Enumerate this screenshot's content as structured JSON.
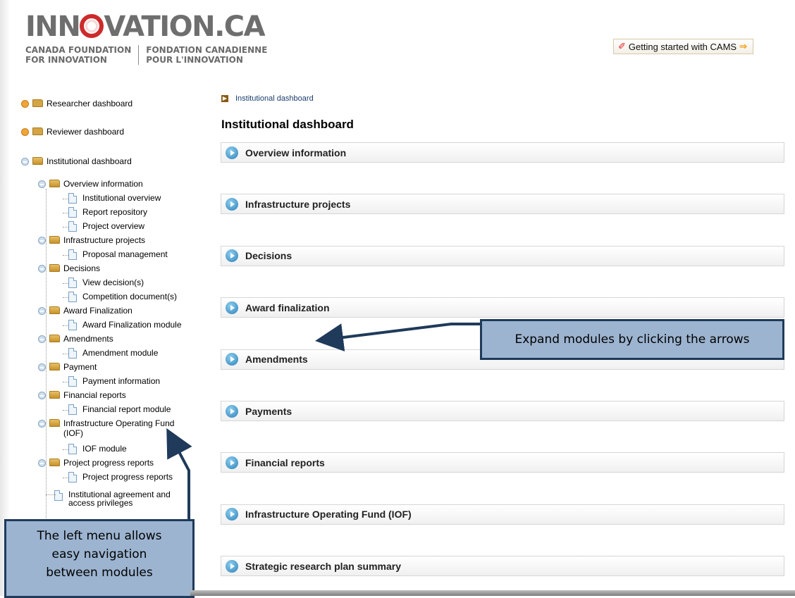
{
  "logo": {
    "main_before": "INN",
    "main_after": "VATION.CA",
    "sub_en_1": "CANADA FOUNDATION",
    "sub_en_2": "FOR INNOVATION",
    "sub_fr_1": "FONDATION CANADIENNE",
    "sub_fr_2": "POUR L'INNOVATION"
  },
  "header": {
    "getting_started": "Getting started with CAMS"
  },
  "sidebar": {
    "researcher": "Researcher dashboard",
    "reviewer": "Reviewer dashboard",
    "institutional": "Institutional dashboard",
    "items": [
      {
        "label": "Overview information",
        "children": [
          "Institutional overview",
          "Report repository",
          "Project overview"
        ]
      },
      {
        "label": "Infrastructure projects",
        "children": [
          "Proposal management"
        ]
      },
      {
        "label": "Decisions",
        "children": [
          "View decision(s)",
          "Competition document(s)"
        ]
      },
      {
        "label": "Award Finalization",
        "children": [
          "Award Finalization module"
        ]
      },
      {
        "label": "Amendments",
        "children": [
          "Amendment module"
        ]
      },
      {
        "label": "Payment",
        "children": [
          "Payment information"
        ]
      },
      {
        "label": "Financial reports",
        "children": [
          "Financial report module"
        ]
      },
      {
        "label": "Infrastructure Operating Fund",
        "label2": "(IOF)",
        "children": [
          "IOF module"
        ]
      },
      {
        "label": "Project progress reports",
        "children": [
          "Project progress reports"
        ]
      }
    ],
    "agreement_1": "Institutional agreement and",
    "agreement_2": "access privileges"
  },
  "main": {
    "breadcrumb": "Institutional dashboard",
    "title": "Institutional dashboard",
    "sections": [
      "Overview information",
      "Infrastructure projects",
      "Decisions",
      "Award finalization",
      "Amendments",
      "Payments",
      "Financial reports",
      "Infrastructure Operating Fund (IOF)",
      "Strategic research plan summary"
    ]
  },
  "callouts": {
    "expand": "Expand modules by clicking the arrows",
    "left_1": "The left menu allows",
    "left_2": "easy navigation",
    "left_3": "between modules"
  },
  "colors": {
    "logo_accent": "#cc2b2b",
    "callout_fill": "#9cb4d0",
    "callout_border": "#1f3a5a",
    "section_icon": "#2a7fb8"
  }
}
